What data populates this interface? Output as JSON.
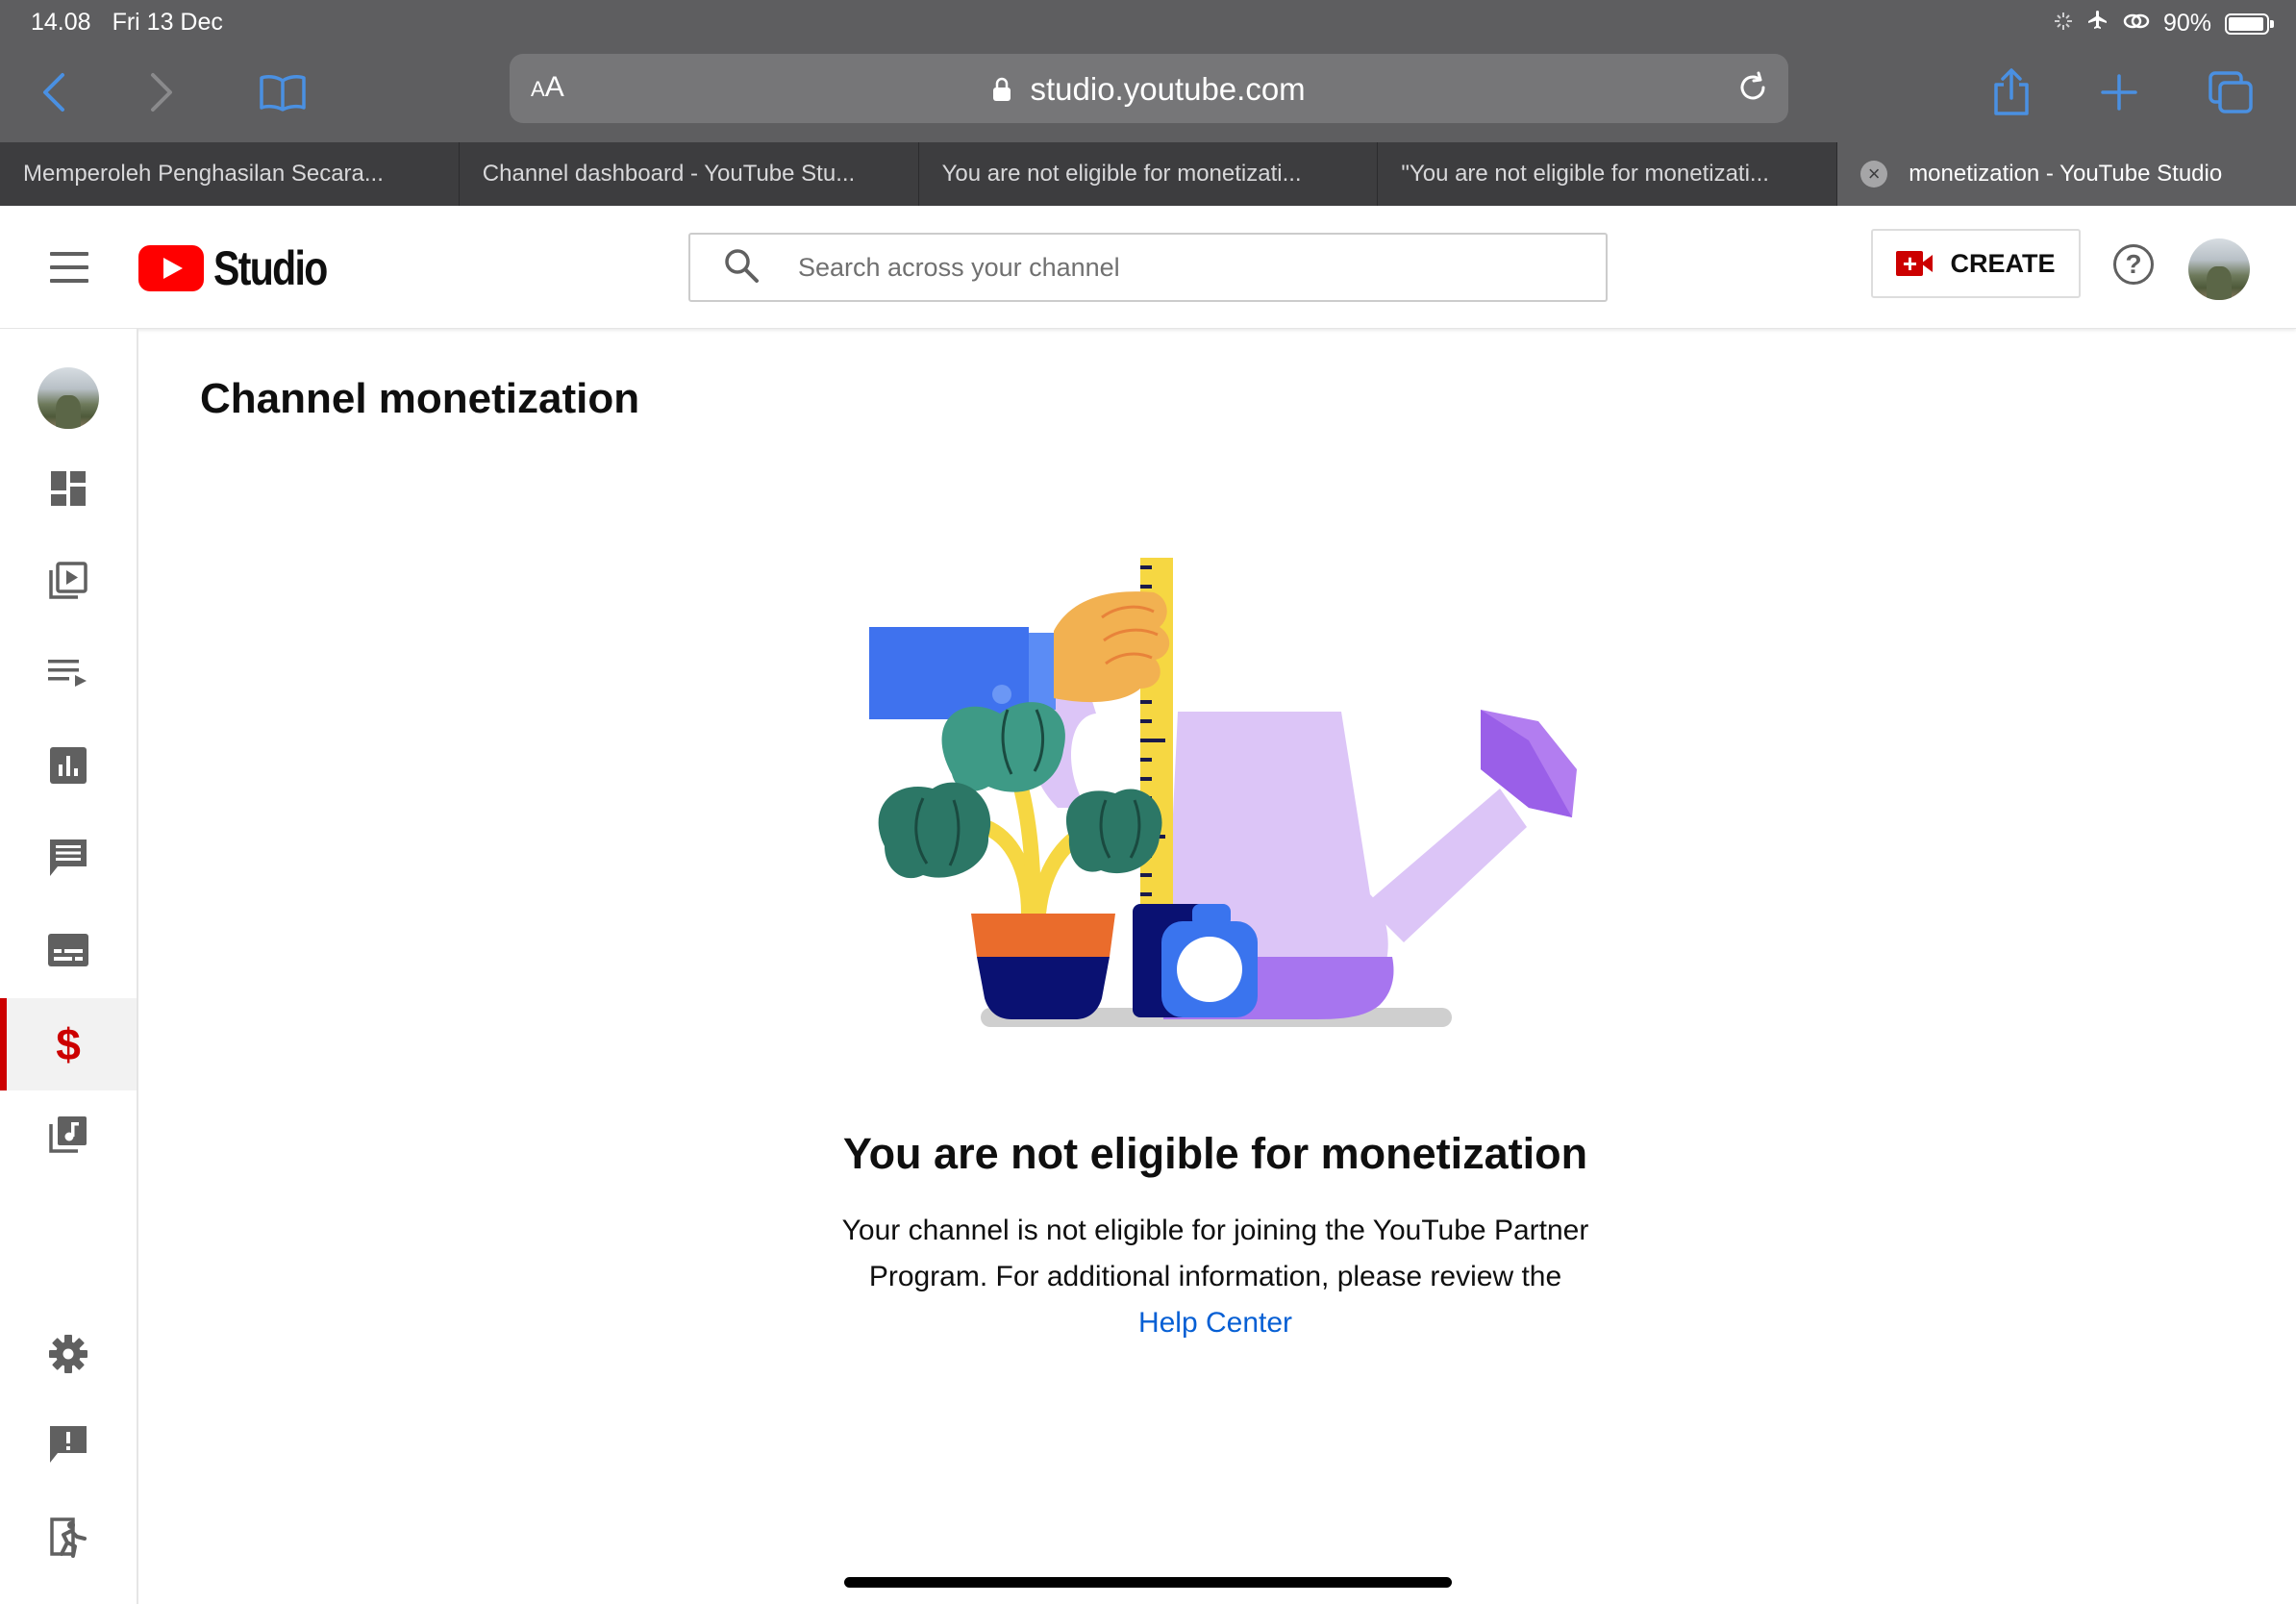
{
  "status_bar": {
    "time": "14.08",
    "date": "Fri 13 Dec",
    "battery": "90%"
  },
  "browser": {
    "text_size_label": "AA",
    "url": "studio.youtube.com",
    "tabs": [
      {
        "title": "Memperoleh Penghasilan Secara..."
      },
      {
        "title": "Channel dashboard - YouTube Stu..."
      },
      {
        "title": "You are not eligible for monetizati..."
      },
      {
        "title": "\"You are not eligible for monetizati..."
      },
      {
        "title": "monetization - YouTube Studio",
        "active": true
      }
    ]
  },
  "header": {
    "logo_text": "Studio",
    "search_placeholder": "Search across your channel",
    "create_label": "CREATE"
  },
  "sidebar": {
    "items": [
      {
        "icon": "dashboard-icon"
      },
      {
        "icon": "videos-icon"
      },
      {
        "icon": "playlists-icon"
      },
      {
        "icon": "analytics-icon"
      },
      {
        "icon": "comments-icon"
      },
      {
        "icon": "subtitles-icon"
      },
      {
        "icon": "monetization-icon",
        "label": "$",
        "active": true
      },
      {
        "icon": "audio-library-icon"
      },
      {
        "icon": "settings-icon"
      },
      {
        "icon": "send-feedback-icon"
      },
      {
        "icon": "creator-studio-classic-icon"
      }
    ]
  },
  "main": {
    "title": "Channel monetization",
    "headline": "You are not eligible for monetization",
    "description": "Your channel is not eligible for joining the YouTube Partner Program. For additional information, please review the",
    "help_link": "Help Center"
  },
  "colors": {
    "accent_red": "#cc0000",
    "link_blue": "#065fd4",
    "safari_chrome": "#5e5e60",
    "safari_blue": "#4a90e2"
  }
}
